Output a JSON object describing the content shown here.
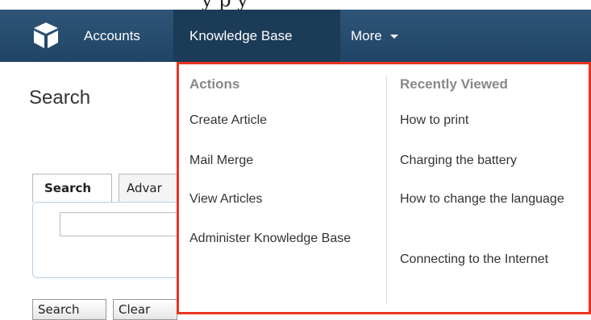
{
  "app": {
    "top_cut_text": "y                          p  y"
  },
  "nav": {
    "logo_icon": "cube-logo-icon",
    "items": [
      {
        "label": "Accounts"
      },
      {
        "label": "Knowledge Base"
      },
      {
        "label": "More"
      }
    ]
  },
  "page": {
    "title": "Search",
    "tabs": [
      {
        "label": "Search"
      },
      {
        "label": "Advar"
      }
    ],
    "search_input": {
      "value": "",
      "placeholder": ""
    },
    "buttons": {
      "search_label": "Search",
      "clear_label": "Clear"
    }
  },
  "dropdown": {
    "highlight_color": "#e8341e",
    "actions_heading": "Actions",
    "actions": [
      {
        "label": "Create Article"
      },
      {
        "label": "Mail Merge"
      },
      {
        "label": "View Articles"
      },
      {
        "label": "Administer Knowledge Base"
      }
    ],
    "recent_heading": "Recently Viewed",
    "recent": [
      {
        "label": "How to print"
      },
      {
        "label": "Charging the battery"
      },
      {
        "label": "How to change the language"
      },
      {
        "label": "Connecting to the Internet"
      }
    ]
  },
  "colors": {
    "nav_bg": "#2e5577",
    "nav_active_bg": "#1b3b57",
    "panel_border": "#b9cfe4"
  }
}
